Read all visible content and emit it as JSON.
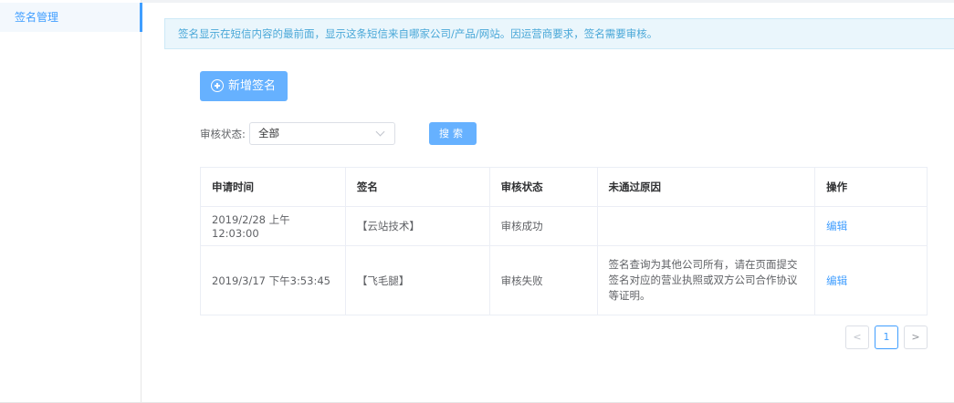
{
  "sidebar": {
    "items": [
      {
        "label": "签名管理"
      }
    ]
  },
  "alert": {
    "text": "签名显示在短信内容的最前面，显示这条短信来自哪家公司/产品/网站。因运营商要求，签名需要审核。"
  },
  "toolbar": {
    "add_label": "新增签名"
  },
  "filter": {
    "status_label": "审核状态:",
    "status_value": "全部",
    "search_label": "搜索"
  },
  "table": {
    "headers": [
      "申请时间",
      "签名",
      "审核状态",
      "未通过原因",
      "操作"
    ],
    "rows": [
      {
        "time": "2019/2/28 上午12:03:00",
        "signature": "【云站技术】",
        "status": "审核成功",
        "reason": "",
        "action": "编辑"
      },
      {
        "time": "2019/3/17 下午3:53:45",
        "signature": "【飞毛腿】",
        "status": "审核失败",
        "reason": "签名查询为其他公司所有，请在页面提交签名对应的营业执照或双方公司合作协议等证明。",
        "action": "编辑"
      }
    ]
  },
  "pagination": {
    "prev": "<",
    "current": "1",
    "next": ">"
  },
  "colors": {
    "primary": "#409eff",
    "button": "#66b1ff",
    "alert_bg": "#eaf6fc",
    "alert_text": "#4aa8d8"
  }
}
